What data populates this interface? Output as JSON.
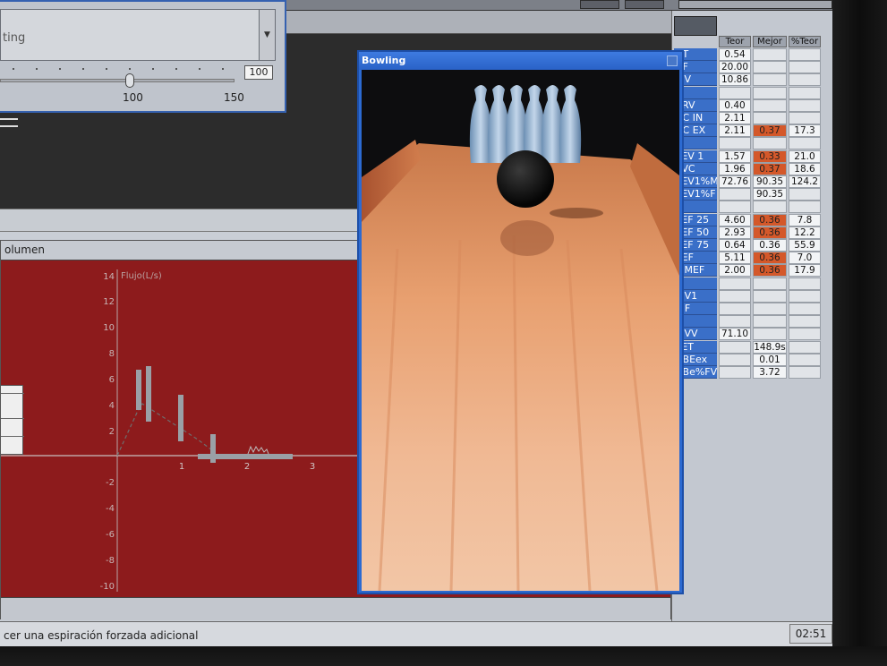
{
  "slider_window": {
    "combo_text": "ting",
    "value": "100",
    "scale_labels": [
      "100",
      "150"
    ]
  },
  "volume_panel": {
    "title": "olumen",
    "y_ticks": [
      "14",
      "12",
      "10",
      "8",
      "6",
      "4",
      "2",
      "-2",
      "-4",
      "-6",
      "-8",
      "-10"
    ],
    "y_axis_title": "Flujo(L/s)",
    "x_ticks": [
      "1",
      "2",
      "3"
    ]
  },
  "bowling_window": {
    "title": "Bowling"
  },
  "results_grid": {
    "columns": [
      "Teor",
      "Mejor",
      "%Teor"
    ],
    "rows": [
      {
        "label": "VT",
        "values": [
          "0.54",
          "",
          ""
        ],
        "highlight": [
          false,
          false,
          false
        ]
      },
      {
        "label": "BF",
        "values": [
          "20.00",
          "",
          ""
        ],
        "highlight": [
          false,
          false,
          false
        ]
      },
      {
        "label": "MV",
        "values": [
          "10.86",
          "",
          ""
        ],
        "highlight": [
          false,
          false,
          false
        ]
      },
      {
        "label": "",
        "values": [
          "",
          "",
          ""
        ],
        "highlight": [
          false,
          false,
          false
        ]
      },
      {
        "label": "ERV",
        "values": [
          "0.40",
          "",
          ""
        ],
        "highlight": [
          false,
          false,
          false
        ]
      },
      {
        "label": "VC IN",
        "values": [
          "2.11",
          "",
          ""
        ],
        "highlight": [
          false,
          false,
          false
        ]
      },
      {
        "label": "VC EX",
        "values": [
          "2.11",
          "0.37",
          "17.3"
        ],
        "highlight": [
          false,
          true,
          false
        ]
      },
      {
        "label": "",
        "values": [
          "",
          "",
          ""
        ],
        "highlight": [
          false,
          false,
          false
        ]
      },
      {
        "label": "FEV 1",
        "values": [
          "1.57",
          "0.33",
          "21.0"
        ],
        "highlight": [
          false,
          true,
          false
        ]
      },
      {
        "label": "FVC",
        "values": [
          "1.96",
          "0.37",
          "18.6"
        ],
        "highlight": [
          false,
          true,
          false
        ]
      },
      {
        "label": "FEV1%M",
        "values": [
          "72.76",
          "90.35",
          "124.2"
        ],
        "highlight": [
          false,
          false,
          false
        ]
      },
      {
        "label": "FEV1%F",
        "values": [
          "",
          "90.35",
          ""
        ],
        "highlight": [
          false,
          false,
          false
        ]
      },
      {
        "label": "",
        "values": [
          "",
          "",
          ""
        ],
        "highlight": [
          false,
          false,
          false
        ]
      },
      {
        "label": "FEF 25",
        "values": [
          "4.60",
          "0.36",
          "7.8"
        ],
        "highlight": [
          false,
          true,
          false
        ]
      },
      {
        "label": "FEF 50",
        "values": [
          "2.93",
          "0.36",
          "12.2"
        ],
        "highlight": [
          false,
          true,
          false
        ]
      },
      {
        "label": "FEF 75",
        "values": [
          "0.64",
          "0.36",
          "55.9"
        ],
        "highlight": [
          false,
          false,
          false
        ]
      },
      {
        "label": "PEF",
        "values": [
          "5.11",
          "0.36",
          "7.0"
        ],
        "highlight": [
          false,
          true,
          false
        ]
      },
      {
        "label": "MMEF",
        "values": [
          "2.00",
          "0.36",
          "17.9"
        ],
        "highlight": [
          false,
          true,
          false
        ]
      },
      {
        "label": "",
        "values": [
          "",
          "",
          ""
        ],
        "highlight": [
          false,
          false,
          false
        ]
      },
      {
        "label": "FIV1",
        "values": [
          "",
          "",
          ""
        ],
        "highlight": [
          false,
          false,
          false
        ]
      },
      {
        "label": "PIF",
        "values": [
          "",
          "",
          ""
        ],
        "highlight": [
          false,
          false,
          false
        ]
      },
      {
        "label": "",
        "values": [
          "",
          "",
          ""
        ],
        "highlight": [
          false,
          false,
          false
        ]
      },
      {
        "label": "MVV",
        "values": [
          "71.10",
          "",
          ""
        ],
        "highlight": [
          false,
          false,
          false
        ]
      },
      {
        "label": "FET",
        "values": [
          "",
          "148.9s",
          ""
        ],
        "highlight": [
          false,
          false,
          false
        ]
      },
      {
        "label": "VBEex",
        "values": [
          "",
          "0.01",
          ""
        ],
        "highlight": [
          false,
          false,
          false
        ]
      },
      {
        "label": "VBe%FV",
        "values": [
          "",
          "3.72",
          ""
        ],
        "highlight": [
          false,
          false,
          false
        ]
      }
    ]
  },
  "status_bar": {
    "message": "cer una espiración forzada adicional",
    "clock": "02:51"
  },
  "colors": {
    "graph_background": "#8d1b1c",
    "grid_label_blue": "#3a6fc8",
    "highlight_orange": "#d4582a",
    "window_blue": "#2c6ad1"
  }
}
